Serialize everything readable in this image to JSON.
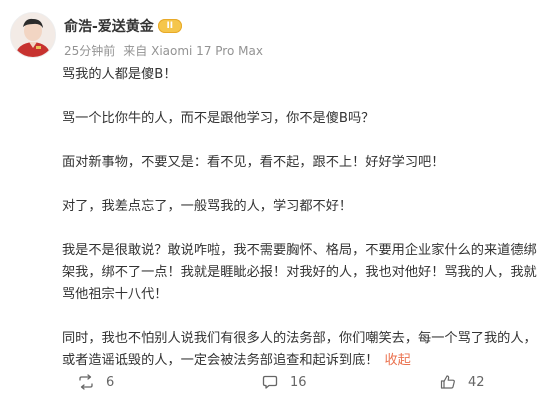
{
  "post": {
    "author_name": "俞浩-爱送黄金",
    "badge_level": "II",
    "time": "25分钟前",
    "source": "来自 Xiaomi 17 Pro Max",
    "paragraphs": [
      "骂我的人都是傻B！",
      "骂一个比你牛的人，而不是跟他学习，你不是傻B吗？",
      "面对新事物，不要又是：看不见，看不起，跟不上！好好学习吧！",
      "对了，我差点忘了，一般骂我的人，学习都不好！",
      "我是不是很敢说？敢说咋啦，我不需要胸怀、格局，不要用企业家什么的来道德绑架我，绑不了一点！我就是睚眦必报！对我好的人，我也对他好！骂我的人，我就骂他祖宗十八代！",
      "同时，我也不怕别人说我们有很多人的法务部，你们嘲笑去，每一个骂了我的人，或者造谣诋毁的人，一定会被法务部追查和起诉到底！"
    ],
    "collapse_label": "收起"
  },
  "actions": {
    "repost_count": "6",
    "comment_count": "16",
    "like_count": "42"
  },
  "colors": {
    "link": "#eb7350",
    "badge": "#f5c64b",
    "meta": "#939393",
    "text": "#333333"
  },
  "icons": {
    "repost": "repost-icon",
    "comment": "comment-icon",
    "like": "like-icon"
  }
}
